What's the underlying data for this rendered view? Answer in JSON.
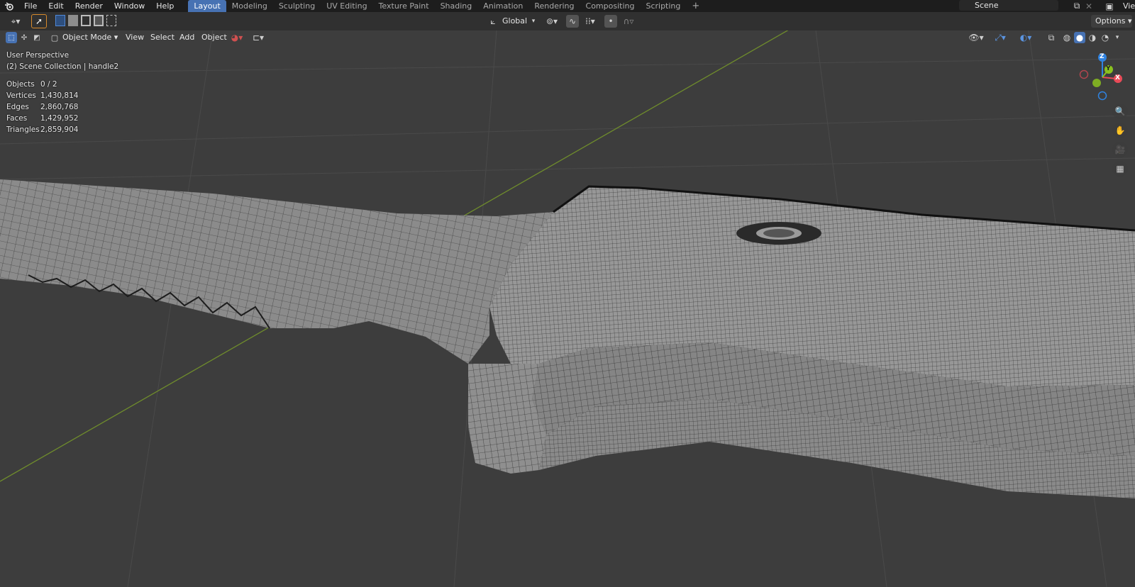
{
  "topbar": {
    "menus": [
      "File",
      "Edit",
      "Render",
      "Window",
      "Help"
    ],
    "workspaces": [
      "Layout",
      "Modeling",
      "Sculpting",
      "UV Editing",
      "Texture Paint",
      "Shading",
      "Animation",
      "Rendering",
      "Compositing",
      "Scripting"
    ],
    "active_workspace": "Layout",
    "add_tab": "+",
    "scene_name": "Scene",
    "view_layer_partial": "Vie"
  },
  "toolbar": {
    "transform_orientation": "Global",
    "options_label": "Options"
  },
  "header": {
    "mode": "Object Mode",
    "view": "View",
    "select": "Select",
    "add": "Add",
    "object": "Object"
  },
  "overlay": {
    "perspective": "User Perspective",
    "collection": "(2) Scene Collection | handle2",
    "stats": [
      {
        "label": "Objects",
        "value": "0 / 2"
      },
      {
        "label": "Vertices",
        "value": "1,430,814"
      },
      {
        "label": "Edges",
        "value": "2,860,768"
      },
      {
        "label": "Faces",
        "value": "1,429,952"
      },
      {
        "label": "Triangles",
        "value": "2,859,904"
      }
    ]
  },
  "gizmo": {
    "z": "Z",
    "y": "Y",
    "x": "X"
  },
  "colors": {
    "accent": "#4772b3",
    "axis_x": "#e94b58",
    "axis_y": "#8ac11f",
    "axis_z": "#2f83e1",
    "ground_line": "#6f8c2c"
  },
  "icons": [
    "blender-logo-icon",
    "editor-type-icon",
    "select-cursor-icon",
    "select-box-mode-icons",
    "transform-orientation-icon",
    "pivot-icon",
    "snap-icon",
    "proportional-edit-icon",
    "scene-icon",
    "new-scene-icon",
    "viewlayer-icon",
    "view-object-types-icon",
    "gizmo-icon",
    "overlay-icon",
    "xray-icon",
    "shading-wireframe-icon",
    "shading-solid-icon",
    "shading-material-icon",
    "shading-rendered-icon",
    "zoom-icon",
    "hand-icon",
    "camera-icon",
    "ortho-grid-icon"
  ]
}
